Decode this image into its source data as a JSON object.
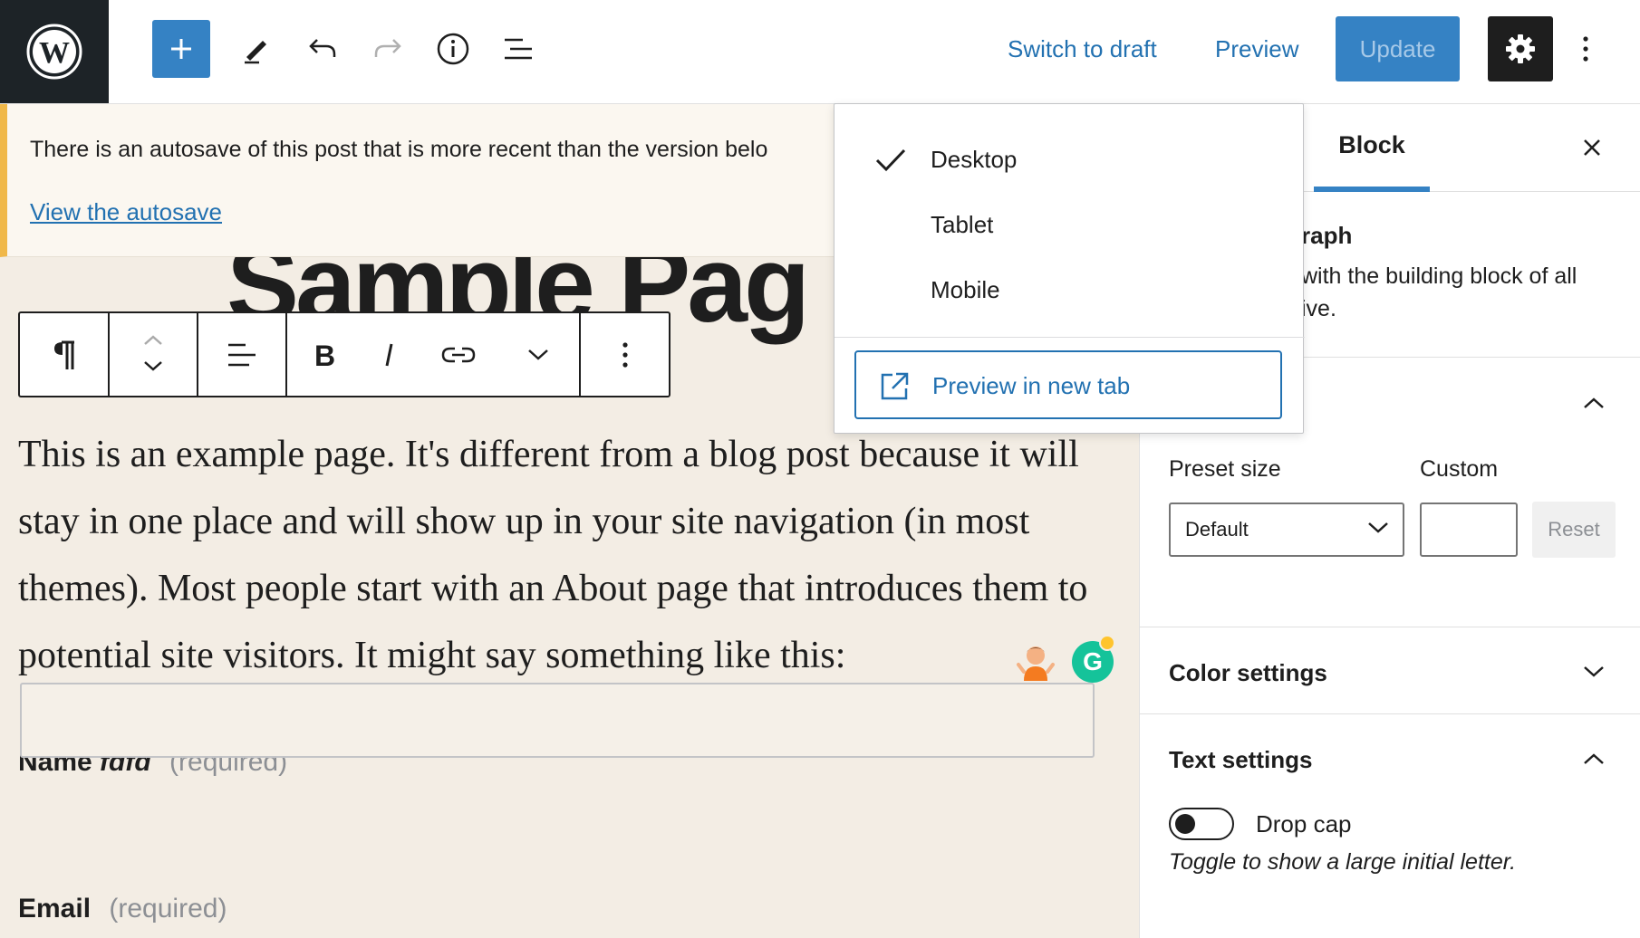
{
  "topbar": {
    "logo_icon": "wordpress-logo-icon",
    "add_icon": "plus-icon",
    "tools": [
      "pencil-icon",
      "undo-icon",
      "redo-icon",
      "info-icon",
      "list-view-icon"
    ],
    "switch_to_draft": "Switch to draft",
    "preview": "Preview",
    "update": "Update",
    "settings_icon": "gear-icon",
    "more_icon": "kebab-menu-icon"
  },
  "notice": {
    "text": "There is an autosave of this post that is more recent than the version belo",
    "link": "View the autosave"
  },
  "page": {
    "title_fragment": "Sample Pag",
    "paragraph": "This is an example page. It's different from a blog post because it will stay in one place and will show up in your site navigation (in most themes). Most people start with an About page that introduces them to potential site visitors. It might say something like this:",
    "field1_label": "Name",
    "field1_label_italic": "fdfd",
    "field1_required": "(required)",
    "field2_label": "Email",
    "field2_required": "(required)"
  },
  "block_toolbar": {
    "tools": [
      "paragraph-icon",
      "move-up-down-icon",
      "align-left-icon",
      "bold-icon",
      "italic-icon",
      "link-icon",
      "chevron-down-icon",
      "more-options-icon"
    ]
  },
  "preview_dropdown": {
    "items": [
      "Desktop",
      "Tablet",
      "Mobile"
    ],
    "selected": "Desktop",
    "new_tab": "Preview in new tab"
  },
  "sidebar": {
    "tab_block": "Block",
    "block_name_fragment": "raph",
    "block_desc_line1": "with the building block of all",
    "block_desc_line2": "ive.",
    "preset_size_label": "Preset size",
    "custom_label": "Custom",
    "preset_value": "Default",
    "reset": "Reset",
    "color_settings": "Color settings",
    "text_settings": "Text settings",
    "drop_cap": "Drop cap",
    "drop_cap_help": "Toggle to show a large initial letter."
  },
  "colors": {
    "accent": "#3582c4",
    "link": "#2271b1",
    "canvas": "#f3ede4",
    "notice_border": "#f0b849"
  }
}
